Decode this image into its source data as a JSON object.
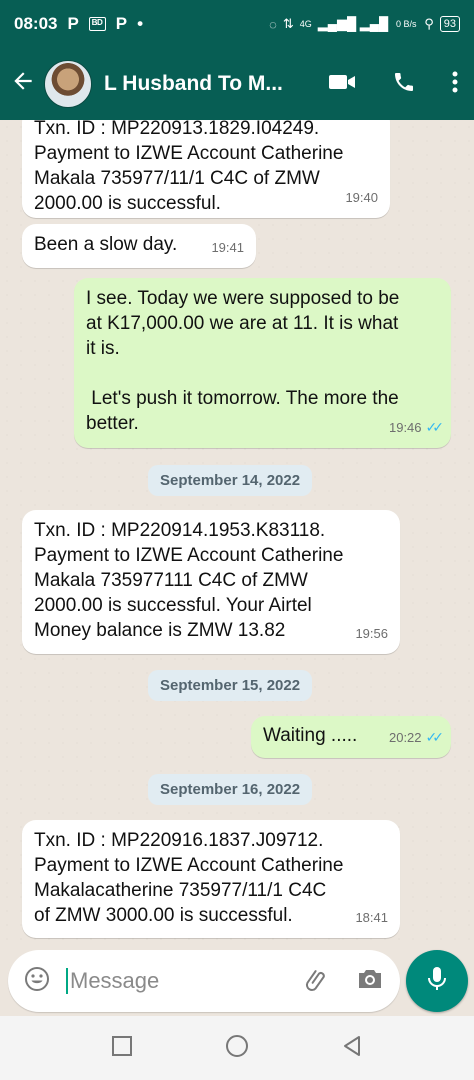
{
  "status_bar": {
    "time": "08:03",
    "left_icons": [
      "P",
      "sim-icon",
      "P",
      "•"
    ],
    "network": "4G",
    "speed": "0 B/s",
    "battery": "93"
  },
  "header": {
    "title": "L Husband To M..."
  },
  "messages": [
    {
      "dir": "in",
      "lines": [
        "Txn. ID : MP220913.1829.I04249.",
        "Payment to IZWE Account Catherine",
        "Makala 735977/11/1 C4C of ZMW",
        "2000.00 is successful."
      ],
      "time": "19:40"
    },
    {
      "dir": "in",
      "lines": [
        "Been a slow day."
      ],
      "time": "19:41"
    },
    {
      "dir": "out",
      "lines": [
        "I see. Today we were supposed to be",
        "at K17,000.00 we are at 11. It is what",
        "it is.",
        "",
        " Let's push it tomorrow. The more the",
        "better."
      ],
      "time": "19:46",
      "read": true
    }
  ],
  "dates": [
    "September 14, 2022",
    "September 15, 2022",
    "September 16, 2022"
  ],
  "messages2": [
    {
      "dir": "in",
      "lines": [
        "Txn. ID : MP220914.1953.K83118.",
        "Payment to IZWE Account Catherine",
        "Makala 735977111 C4C of ZMW",
        "2000.00 is successful. Your Airtel",
        "Money balance is ZMW 13.82"
      ],
      "time": "19:56"
    },
    {
      "dir": "out",
      "lines": [
        "Waiting ....."
      ],
      "time": "20:22",
      "read": true
    },
    {
      "dir": "in",
      "lines": [
        "Txn. ID : MP220916.1837.J09712.",
        "Payment to IZWE Account Catherine",
        "Makalacatherine 735977/11/1 C4C",
        "of ZMW 3000.00 is successful."
      ],
      "time": "18:41"
    }
  ],
  "composer": {
    "placeholder": "Message"
  },
  "colors": {
    "header": "#075e54",
    "outgoing": "#dcf8c6",
    "incoming": "#ffffff",
    "accent": "#00897b",
    "read_ticks": "#34b7f1"
  }
}
